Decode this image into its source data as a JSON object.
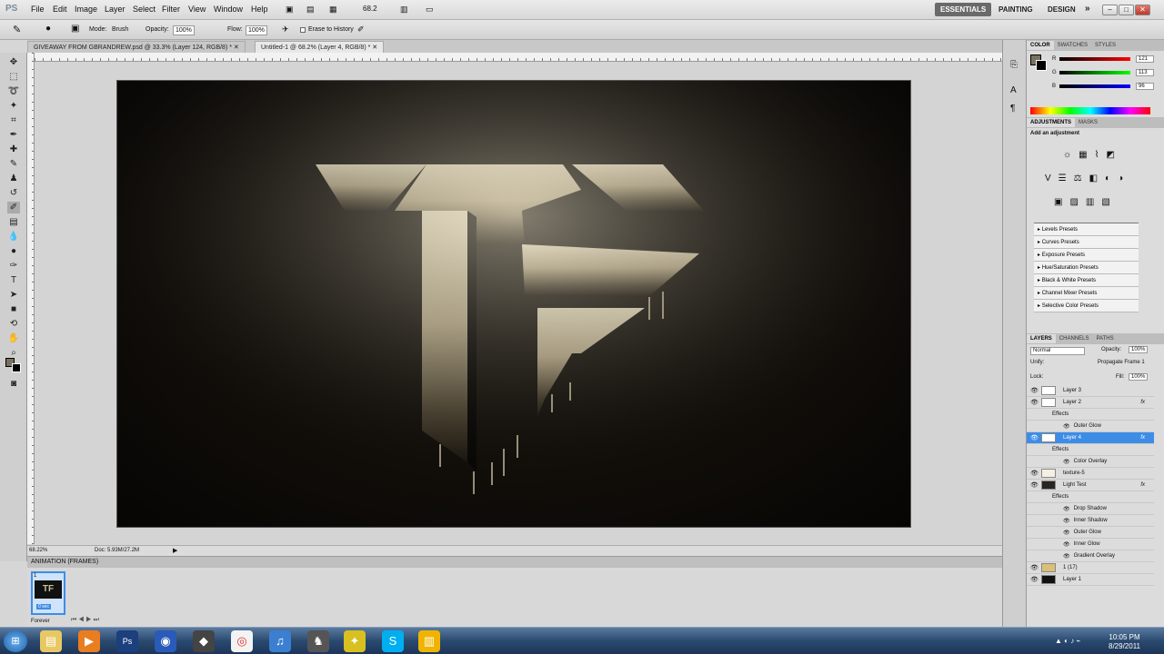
{
  "app": {
    "logo": "PS"
  },
  "menu": {
    "items": [
      "File",
      "Edit",
      "Image",
      "Layer",
      "Select",
      "Filter",
      "View",
      "Window",
      "Help"
    ],
    "zoom_value": "68.2"
  },
  "workspaces": {
    "essentials": "ESSENTIALS",
    "painting": "PAINTING",
    "design": "DESIGN",
    "more": "»"
  },
  "options": {
    "mode_label": "Mode:",
    "mode_value": "Brush",
    "opacity_label": "Opacity:",
    "opacity_value": "100%",
    "flow_label": "Flow:",
    "flow_value": "100%",
    "erase_label": "Erase to History"
  },
  "doc_tabs": [
    {
      "label": "GIVEAWAY FROM GBRANDREW.psd @ 33.3% (Layer 124, RGB/8) *"
    },
    {
      "label": "Untitled-1 @ 68.2% (Layer 4, RGB/8) *"
    }
  ],
  "status": {
    "zoom": "68.22%",
    "doc": "Doc: 5.93M/27.2M"
  },
  "animation": {
    "title": "ANIMATION (FRAMES)",
    "frame_number": "1",
    "frame_time": "0 sec",
    "loop": "Forever"
  },
  "color_panel": {
    "tabs": [
      "COLOR",
      "SWATCHES",
      "STYLES"
    ],
    "r_label": "R",
    "r_value": "121",
    "g_label": "G",
    "g_value": "113",
    "b_label": "B",
    "b_value": "96"
  },
  "adjustments": {
    "tabs": [
      "ADJUSTMENTS",
      "MASKS"
    ],
    "heading": "Add an adjustment",
    "presets": [
      "Levels Presets",
      "Curves Presets",
      "Exposure Presets",
      "Hue/Saturation Presets",
      "Black & White Presets",
      "Channel Mixer Presets",
      "Selective Color Presets"
    ]
  },
  "layers": {
    "tabs": [
      "LAYERS",
      "CHANNELS",
      "PATHS"
    ],
    "blend_mode": "Normal",
    "opacity_label": "Opacity:",
    "opacity_value": "100%",
    "unify_label": "Unify:",
    "propagate_label": "Propagate Frame 1",
    "lock_label": "Lock:",
    "fill_label": "Fill:",
    "fill_value": "100%",
    "rows": [
      {
        "name": "Layer 3",
        "indent": 0,
        "fx": "",
        "thumb": "blank"
      },
      {
        "name": "Layer 2",
        "indent": 0,
        "fx": "fx",
        "thumb": "blank"
      },
      {
        "name": "Effects",
        "indent": 1,
        "fx": "",
        "thumb": "none"
      },
      {
        "name": "Outer Glow",
        "indent": 2,
        "fx": "",
        "thumb": "none"
      },
      {
        "name": "Layer 4",
        "indent": 0,
        "fx": "fx",
        "thumb": "blank",
        "selected": true
      },
      {
        "name": "Effects",
        "indent": 1,
        "fx": "",
        "thumb": "none"
      },
      {
        "name": "Color Overlay",
        "indent": 2,
        "fx": "",
        "thumb": "none"
      },
      {
        "name": "texture-5",
        "indent": 0,
        "fx": "",
        "thumb": "light"
      },
      {
        "name": "Light Test",
        "indent": 0,
        "fx": "fx",
        "thumb": "logo"
      },
      {
        "name": "Effects",
        "indent": 1,
        "fx": "",
        "thumb": "none"
      },
      {
        "name": "Drop Shadow",
        "indent": 2,
        "fx": "",
        "thumb": "none"
      },
      {
        "name": "Inner Shadow",
        "indent": 2,
        "fx": "",
        "thumb": "none"
      },
      {
        "name": "Outer Glow",
        "indent": 2,
        "fx": "",
        "thumb": "none"
      },
      {
        "name": "Inner Glow",
        "indent": 2,
        "fx": "",
        "thumb": "none"
      },
      {
        "name": "Gradient Overlay",
        "indent": 2,
        "fx": "",
        "thumb": "none"
      },
      {
        "name": "1 (17)",
        "indent": 0,
        "fx": "",
        "thumb": "tan"
      },
      {
        "name": "Layer 1",
        "indent": 0,
        "fx": "",
        "thumb": "dark"
      }
    ]
  },
  "taskbar": {
    "time": "10:05 PM",
    "date": "8/29/2011"
  },
  "colors": {
    "accent": "#3d8de6",
    "canvas": "#100d09",
    "logo_light": "#d8cdb0"
  }
}
